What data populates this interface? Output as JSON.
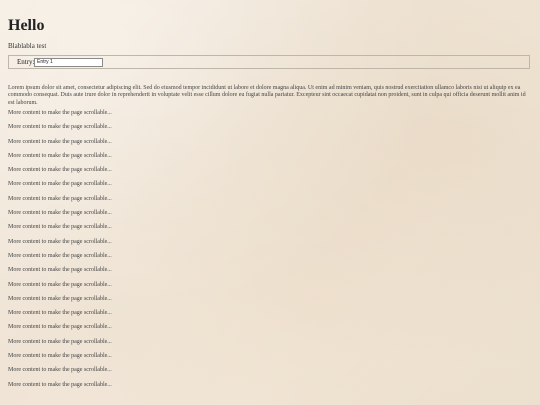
{
  "header": {
    "title": "Hello",
    "subtitle": "Blablabla test"
  },
  "entry": {
    "label": "Entry:",
    "value": "Entry 1"
  },
  "content": {
    "lorem": "Lorem ipsum dolor sit amet, consectetur adipiscing elit. Sed do eiusmod tempor incididunt ut labore et dolore magna aliqua. Ut enim ad minim veniam, quis nostrud exercitation ullamco laboris nisi ut aliquip ex ea commodo consequat. Duis aute irure dolor in reprehenderit in voluptate velit esse cillum dolore eu fugiat nulla pariatur. Excepteur sint occaecat cupidatat non proident, sunt in culpa qui officia deserunt mollit anim id est laborum.",
    "more_items": [
      "More content to make the page scrollable...",
      "More content to make the page scrollable...",
      "More content to make the page scrollable...",
      "More content to make the page scrollable...",
      "More content to make the page scrollable...",
      "More content to make the page scrollable...",
      "More content to make the page scrollable...",
      "More content to make the page scrollable...",
      "More content to make the page scrollable...",
      "More content to make the page scrollable...",
      "More content to make the page scrollable...",
      "More content to make the page scrollable...",
      "More content to make the page scrollable...",
      "More content to make the page scrollable...",
      "More content to make the page scrollable...",
      "More content to make the page scrollable...",
      "More content to make the page scrollable...",
      "More content to make the page scrollable...",
      "More content to make the page scrollable...",
      "More content to make the page scrollable..."
    ]
  }
}
